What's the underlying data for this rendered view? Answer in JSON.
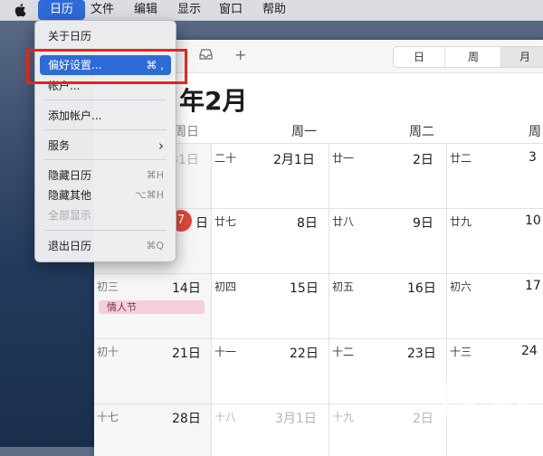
{
  "menubar": {
    "items": [
      "日历",
      "文件",
      "编辑",
      "显示",
      "窗口",
      "帮助"
    ],
    "active_index": 0
  },
  "menu": {
    "items": [
      {
        "label": "关于日历",
        "shortcut": ""
      },
      {
        "label": "偏好设置...",
        "shortcut": "⌘ ,"
      },
      {
        "label": "帐户...",
        "shortcut": ""
      },
      {
        "label": "添加帐户...",
        "shortcut": ""
      },
      {
        "label": "服务",
        "shortcut": "›"
      },
      {
        "label": "隐藏日历",
        "shortcut": "⌘H"
      },
      {
        "label": "隐藏其他",
        "shortcut": "⌥⌘H"
      },
      {
        "label": "全部显示",
        "shortcut": ""
      },
      {
        "label": "退出日历",
        "shortcut": "⌘Q"
      }
    ]
  },
  "toolbar": {
    "view_tabs": [
      "日",
      "周",
      "月"
    ],
    "selected_view": "月",
    "add_symbol": "+"
  },
  "calendar": {
    "title": "年2月",
    "weekdays": [
      "周日",
      "周一",
      "周二",
      "周"
    ],
    "today": "7",
    "weeks": [
      [
        {
          "lunar": "",
          "day": "31日",
          "muted": true
        },
        {
          "lunar": "二十",
          "day": "2月1日"
        },
        {
          "lunar": "廿一",
          "day": "2日"
        },
        {
          "lunar": "廿二",
          "day": "3"
        }
      ],
      [
        {
          "lunar": "",
          "day": "日"
        },
        {
          "lunar": "廿七",
          "day": "8日"
        },
        {
          "lunar": "廿八",
          "day": "9日"
        },
        {
          "lunar": "廿九",
          "day": "10"
        }
      ],
      [
        {
          "lunar": "初三",
          "day": "14日"
        },
        {
          "lunar": "初四",
          "day": "15日"
        },
        {
          "lunar": "初五",
          "day": "16日"
        },
        {
          "lunar": "初六",
          "day": "17"
        }
      ],
      [
        {
          "lunar": "初十",
          "day": "21日"
        },
        {
          "lunar": "十一",
          "day": "22日"
        },
        {
          "lunar": "十二",
          "day": "23日"
        },
        {
          "lunar": "十三",
          "day": "24"
        }
      ],
      [
        {
          "lunar": "十七",
          "day": "28日"
        },
        {
          "lunar": "十八",
          "day": "3月1日",
          "muted": true
        },
        {
          "lunar": "十九",
          "day": "2日",
          "muted": true
        },
        {
          "lunar": "",
          "day": ""
        }
      ]
    ],
    "event": "情人节"
  },
  "colors": {
    "accent": "#2f6bd7",
    "today": "#e0473b",
    "event_bg": "#f6cfdd",
    "annotation": "#e0261d"
  }
}
